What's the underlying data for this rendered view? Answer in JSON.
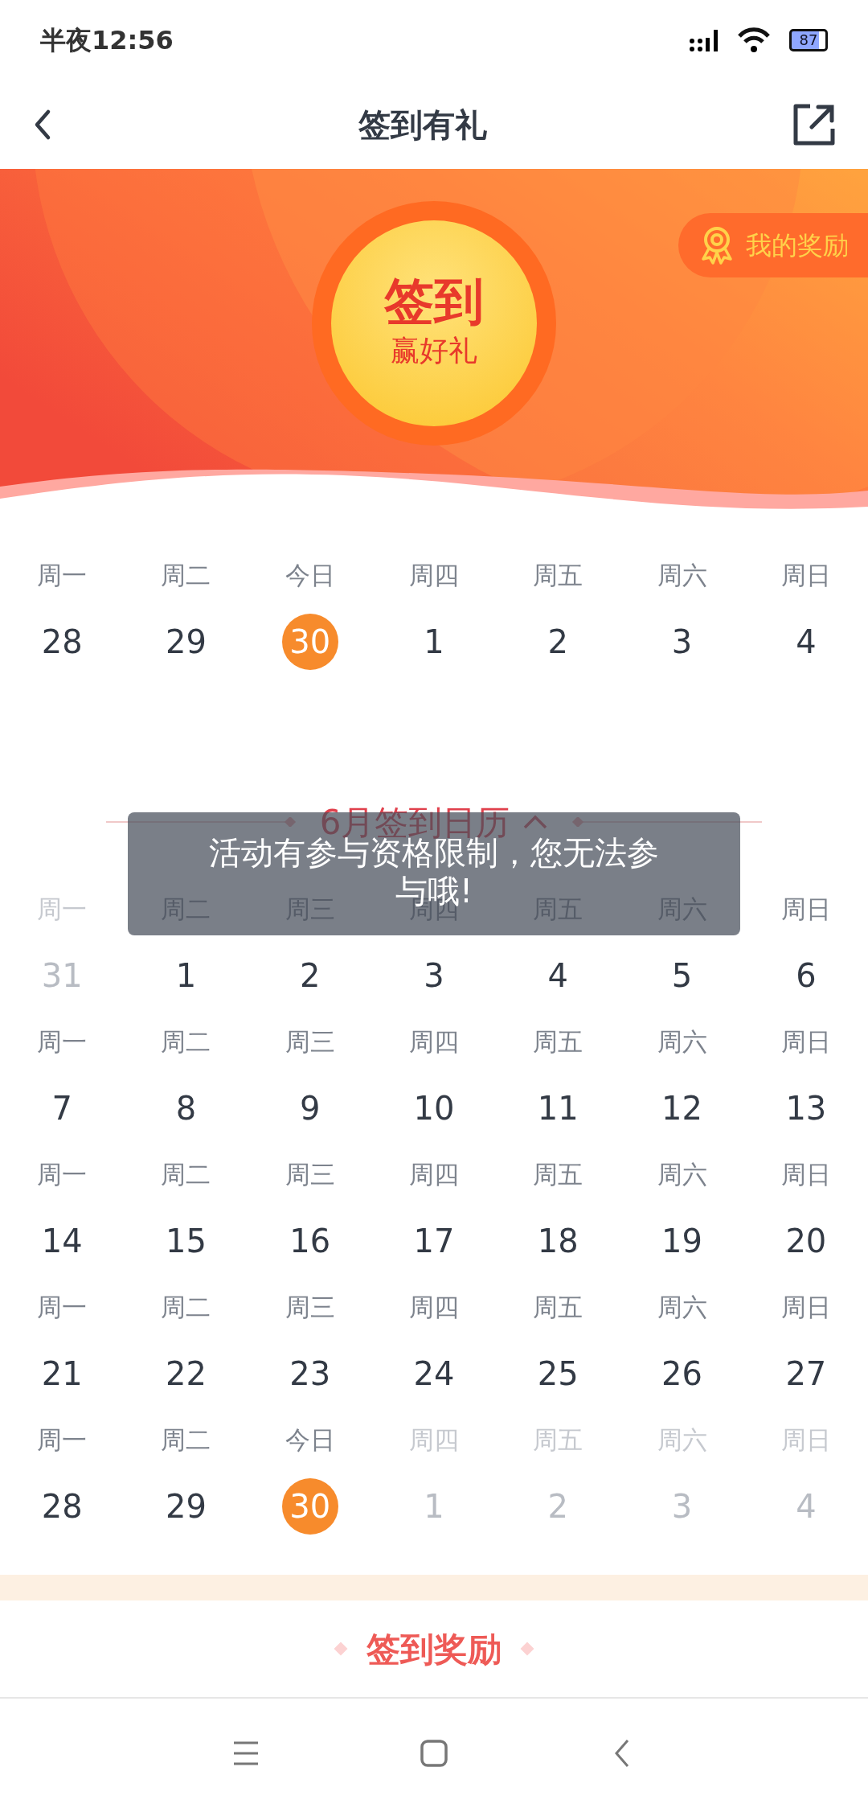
{
  "status_bar": {
    "time": "半夜12:56",
    "battery": "87"
  },
  "header": {
    "title": "签到有礼"
  },
  "banner": {
    "badge_title": "签到",
    "badge_subtitle": "赢好礼",
    "rewards_button": "我的奖励"
  },
  "week_strip": [
    {
      "weekday": "周一",
      "day": "28",
      "today": false,
      "muted": false
    },
    {
      "weekday": "周二",
      "day": "29",
      "today": false,
      "muted": false
    },
    {
      "weekday": "今日",
      "day": "30",
      "today": true,
      "muted": false
    },
    {
      "weekday": "周四",
      "day": "1",
      "today": false,
      "muted": false
    },
    {
      "weekday": "周五",
      "day": "2",
      "today": false,
      "muted": false
    },
    {
      "weekday": "周六",
      "day": "3",
      "today": false,
      "muted": false
    },
    {
      "weekday": "周日",
      "day": "4",
      "today": false,
      "muted": false
    }
  ],
  "calendar": {
    "title": "6月签到日历",
    "expanded": true,
    "weeks": [
      [
        {
          "weekday": "周一",
          "day": "31",
          "today": false,
          "muted": true
        },
        {
          "weekday": "周二",
          "day": "1",
          "today": false,
          "muted": false
        },
        {
          "weekday": "周三",
          "day": "2",
          "today": false,
          "muted": false
        },
        {
          "weekday": "周四",
          "day": "3",
          "today": false,
          "muted": false
        },
        {
          "weekday": "周五",
          "day": "4",
          "today": false,
          "muted": false
        },
        {
          "weekday": "周六",
          "day": "5",
          "today": false,
          "muted": false
        },
        {
          "weekday": "周日",
          "day": "6",
          "today": false,
          "muted": false
        }
      ],
      [
        {
          "weekday": "周一",
          "day": "7",
          "today": false,
          "muted": false
        },
        {
          "weekday": "周二",
          "day": "8",
          "today": false,
          "muted": false
        },
        {
          "weekday": "周三",
          "day": "9",
          "today": false,
          "muted": false
        },
        {
          "weekday": "周四",
          "day": "10",
          "today": false,
          "muted": false
        },
        {
          "weekday": "周五",
          "day": "11",
          "today": false,
          "muted": false
        },
        {
          "weekday": "周六",
          "day": "12",
          "today": false,
          "muted": false
        },
        {
          "weekday": "周日",
          "day": "13",
          "today": false,
          "muted": false
        }
      ],
      [
        {
          "weekday": "周一",
          "day": "14",
          "today": false,
          "muted": false
        },
        {
          "weekday": "周二",
          "day": "15",
          "today": false,
          "muted": false
        },
        {
          "weekday": "周三",
          "day": "16",
          "today": false,
          "muted": false
        },
        {
          "weekday": "周四",
          "day": "17",
          "today": false,
          "muted": false
        },
        {
          "weekday": "周五",
          "day": "18",
          "today": false,
          "muted": false
        },
        {
          "weekday": "周六",
          "day": "19",
          "today": false,
          "muted": false
        },
        {
          "weekday": "周日",
          "day": "20",
          "today": false,
          "muted": false
        }
      ],
      [
        {
          "weekday": "周一",
          "day": "21",
          "today": false,
          "muted": false
        },
        {
          "weekday": "周二",
          "day": "22",
          "today": false,
          "muted": false
        },
        {
          "weekday": "周三",
          "day": "23",
          "today": false,
          "muted": false
        },
        {
          "weekday": "周四",
          "day": "24",
          "today": false,
          "muted": false
        },
        {
          "weekday": "周五",
          "day": "25",
          "today": false,
          "muted": false
        },
        {
          "weekday": "周六",
          "day": "26",
          "today": false,
          "muted": false
        },
        {
          "weekday": "周日",
          "day": "27",
          "today": false,
          "muted": false
        }
      ],
      [
        {
          "weekday": "周一",
          "day": "28",
          "today": false,
          "muted": false
        },
        {
          "weekday": "周二",
          "day": "29",
          "today": false,
          "muted": false
        },
        {
          "weekday": "今日",
          "day": "30",
          "today": true,
          "muted": false
        },
        {
          "weekday": "周四",
          "day": "1",
          "today": false,
          "muted": true
        },
        {
          "weekday": "周五",
          "day": "2",
          "today": false,
          "muted": true
        },
        {
          "weekday": "周六",
          "day": "3",
          "today": false,
          "muted": true
        },
        {
          "weekday": "周日",
          "day": "4",
          "today": false,
          "muted": true
        }
      ]
    ]
  },
  "toast": "活动有参与资格限制，您无法参与哦!",
  "rewards_section": {
    "title": "签到奖励"
  }
}
